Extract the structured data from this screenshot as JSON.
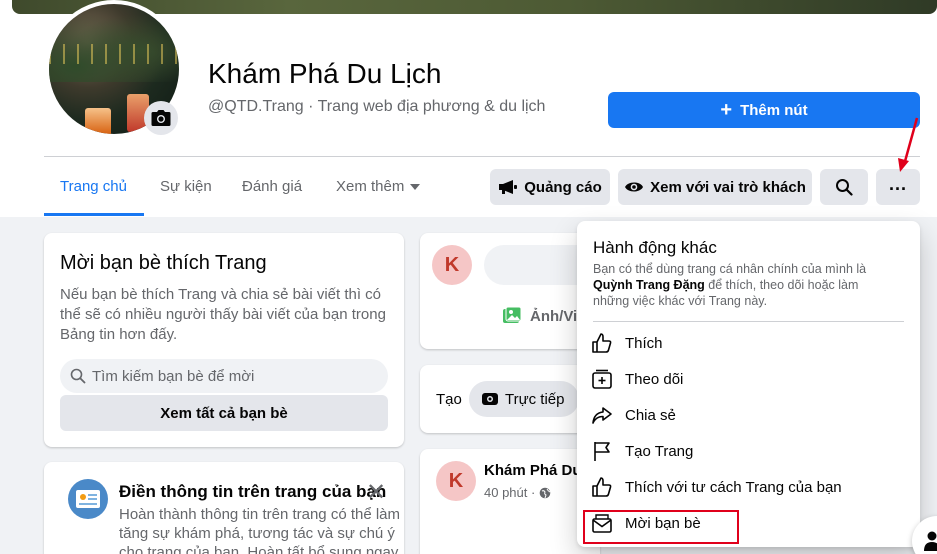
{
  "page": {
    "name": "Khám Phá Du Lịch",
    "handle_category": "@QTD.Trang · Trang web địa phương & du lịch"
  },
  "header": {
    "add_button": "Thêm nút"
  },
  "tabs": [
    {
      "label": "Trang chủ",
      "active": true
    },
    {
      "label": "Sự kiện"
    },
    {
      "label": "Đánh giá"
    },
    {
      "label": "Xem thêm"
    }
  ],
  "actions": {
    "ads": "Quảng cáo",
    "view_as_visitor": "Xem với vai trò khách"
  },
  "invite_card": {
    "title": "Mời bạn bè thích Trang",
    "description": "Nếu bạn bè thích Trang và chia sẻ bài viết thì có thể sẽ có nhiều người thấy bài viết của bạn trong Bảng tin hơn đấy.",
    "search_placeholder": "Tìm kiếm bạn bè để mời",
    "see_all": "Xem tất cả bạn bè"
  },
  "info_card": {
    "title": "Điền thông tin trên trang của bạn",
    "description": "Hoàn thành thông tin trên trang có thể làm tăng sự khám phá, tương tác và sự chú ý cho trang của bạn. Hoàn tất bổ sung ngay"
  },
  "composer": {
    "avatar_letter": "K",
    "photo_video": "Ảnh/Vi",
    "create_label": "Tạo",
    "live": "Trực tiếp"
  },
  "post": {
    "avatar_letter": "K",
    "author": "Khám Phá Du",
    "time": "40 phút ·"
  },
  "dropdown": {
    "title": "Hành động khác",
    "desc_before": "Bạn có thể dùng trang cá nhân chính của mình là ",
    "desc_name": "Quỳnh Trang Đặng",
    "desc_after": " để thích, theo dõi hoặc làm những việc khác với Trang này.",
    "items": [
      {
        "label": "Thích",
        "icon": "thumbs-up-icon"
      },
      {
        "label": "Theo dõi",
        "icon": "follow-icon"
      },
      {
        "label": "Chia sẻ",
        "icon": "share-icon"
      },
      {
        "label": "Tạo Trang",
        "icon": "flag-icon"
      },
      {
        "label": "Thích với tư cách Trang của bạn",
        "icon": "thumbs-up-icon"
      },
      {
        "label": "Mời bạn bè",
        "icon": "envelope-icon"
      }
    ]
  },
  "colors": {
    "primary": "#1877f2",
    "highlight": "#e0001b",
    "secondary_text": "#65676b",
    "button_gray": "#e4e6eb"
  }
}
